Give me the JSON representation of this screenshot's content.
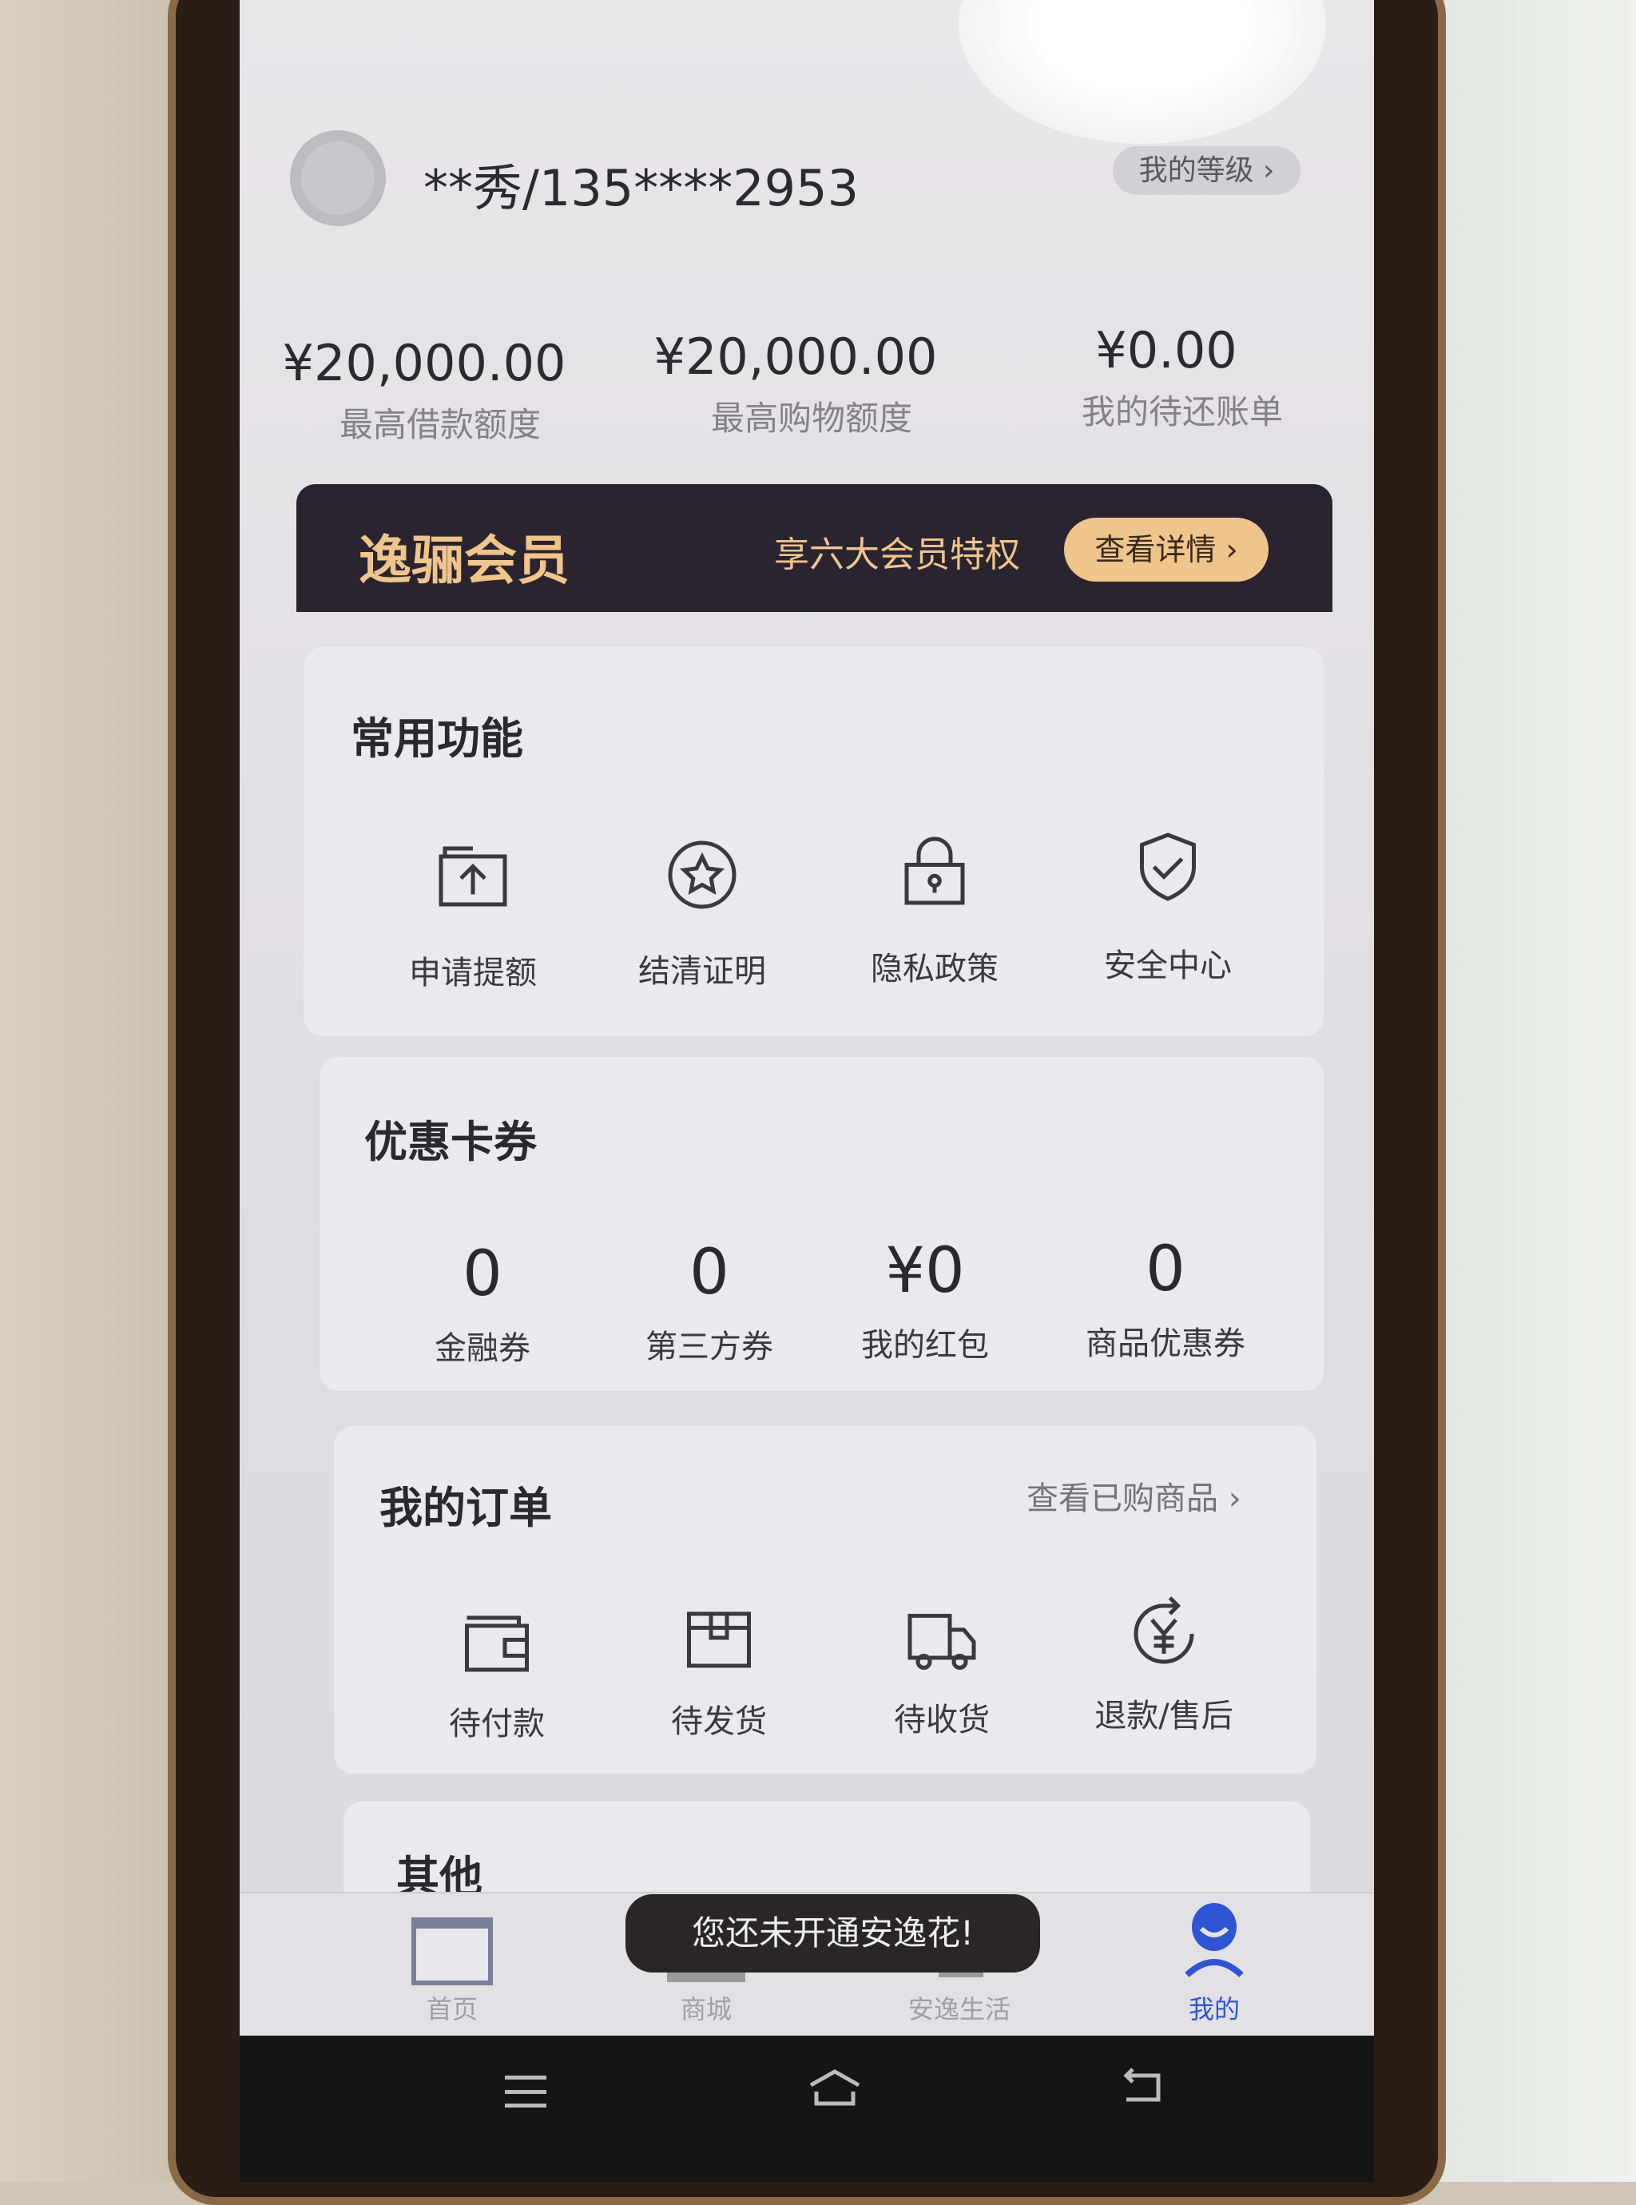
{
  "profile": {
    "name": "**秀/135****2953",
    "chevron": "›",
    "level_button": "我的等级 ›"
  },
  "stats": [
    {
      "amount": "¥20,000.00",
      "label": "最高借款额度"
    },
    {
      "amount": "¥20,000.00",
      "label": "最高购物额度"
    },
    {
      "amount": "¥0.00",
      "label": "我的待还账单"
    }
  ],
  "membership": {
    "title": "逸骊会员",
    "promo": "享六大会员特权",
    "button": "查看详情 ›",
    "accent": "#f0c58c",
    "bg": "#2a2430"
  },
  "common": {
    "title": "常用功能",
    "items": [
      {
        "label": "申请提额",
        "icon": "upload-box-icon"
      },
      {
        "label": "结清证明",
        "icon": "star-circle-icon"
      },
      {
        "label": "隐私政策",
        "icon": "lock-icon"
      },
      {
        "label": "安全中心",
        "icon": "shield-check-icon"
      }
    ]
  },
  "coupons": {
    "title": "优惠卡券",
    "items": [
      {
        "value": "0",
        "label": "金融券"
      },
      {
        "value": "0",
        "label": "第三方券"
      },
      {
        "value": "¥0",
        "label": "我的红包"
      },
      {
        "value": "0",
        "label": "商品优惠券"
      }
    ]
  },
  "orders": {
    "title": "我的订单",
    "link": "查看已购商品 ›",
    "items": [
      {
        "label": "待付款",
        "icon": "wallet-icon"
      },
      {
        "label": "待发货",
        "icon": "package-icon"
      },
      {
        "label": "待收货",
        "icon": "truck-icon"
      },
      {
        "label": "退款/售后",
        "icon": "refund-icon"
      }
    ]
  },
  "other": {
    "title": "其他"
  },
  "toast": "您还未开通安逸花!",
  "tabs": [
    {
      "label": "首页"
    },
    {
      "label": "商城"
    },
    {
      "label": "安逸生活"
    },
    {
      "label": "我的",
      "active": true
    }
  ],
  "colors": {
    "active_tab": "#2f55d4"
  }
}
